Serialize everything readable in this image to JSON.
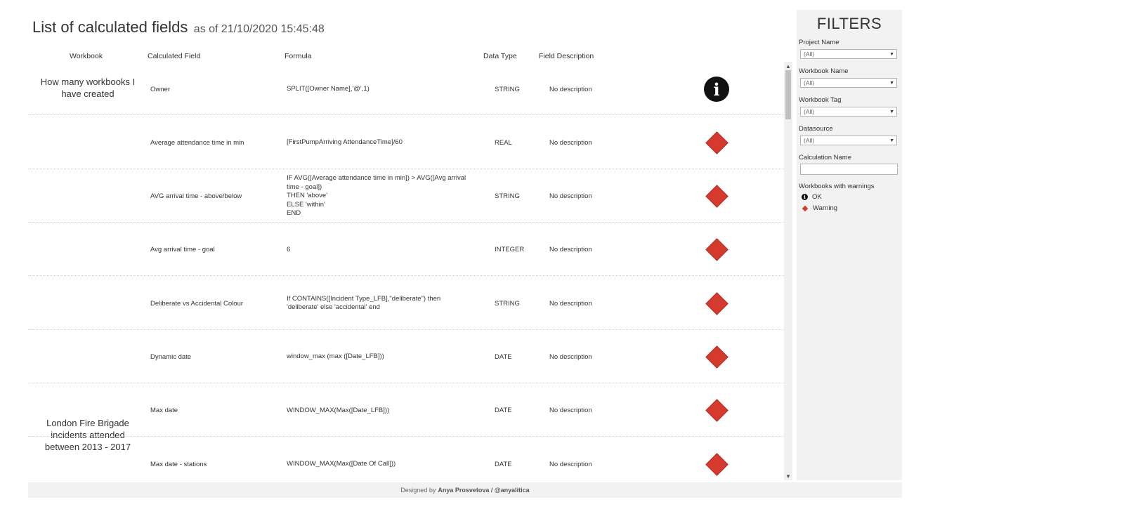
{
  "title": {
    "main": "List of calculated fields",
    "as_of": "as of 21/10/2020 15:45:48"
  },
  "columns": {
    "workbook": "Workbook",
    "field": "Calculated Field",
    "formula": "Formula",
    "type": "Data Type",
    "description": "Field Description"
  },
  "workbooks": [
    {
      "name": "How many workbooks I have created"
    },
    {
      "name": "London Fire Brigade incidents attended between 2013 - 2017"
    }
  ],
  "rows": [
    {
      "field": "Owner",
      "formula": [
        "SPLIT([Owner Name],'@',1)"
      ],
      "type": "STRING",
      "description": "No description",
      "status": "ok",
      "icon": "info-icon"
    },
    {
      "field": "Average attendance time in min",
      "formula": [
        "[FirstPumpArriving AttendanceTime]/60"
      ],
      "type": "REAL",
      "description": "No description",
      "status": "warning",
      "icon": "warning-diamond-icon"
    },
    {
      "field": "AVG arrival time - above/below",
      "formula": [
        "IF AVG([Average attendance time in min]) > AVG([Avg arrival",
        "time - goal])",
        "THEN 'above'",
        "ELSE 'within'",
        "END"
      ],
      "type": "STRING",
      "description": "No description",
      "status": "warning",
      "icon": "warning-diamond-icon"
    },
    {
      "field": "Avg arrival time - goal",
      "formula": [
        "6"
      ],
      "type": "INTEGER",
      "description": "No description",
      "status": "warning",
      "icon": "warning-diamond-icon"
    },
    {
      "field": "Deliberate vs Accidental Colour",
      "formula": [
        "If CONTAINS([Incident Type_LFB],\"deliberate\") then",
        "'deliberate' else 'accidental' end"
      ],
      "type": "STRING",
      "description": "No description",
      "status": "warning",
      "icon": "warning-diamond-icon"
    },
    {
      "field": "Dynamic date",
      "formula": [
        "window_max (max ([Date_LFB]))"
      ],
      "type": "DATE",
      "description": "No description",
      "status": "warning",
      "icon": "warning-diamond-icon"
    },
    {
      "field": "Max date",
      "formula": [
        "WINDOW_MAX(Max([Date_LFB]))"
      ],
      "type": "DATE",
      "description": "No description",
      "status": "warning",
      "icon": "warning-diamond-icon"
    },
    {
      "field": "Max date - stations",
      "formula": [
        "WINDOW_MAX(Max([Date Of Call]))"
      ],
      "type": "DATE",
      "description": "No description",
      "status": "warning",
      "icon": "warning-diamond-icon"
    }
  ],
  "filters": {
    "heading": "FILTERS",
    "project_name": {
      "label": "Project Name",
      "value": "(All)"
    },
    "workbook_name": {
      "label": "Workbook Name",
      "value": "(All)"
    },
    "workbook_tag": {
      "label": "Workbook Tag",
      "value": "(All)"
    },
    "datasource": {
      "label": "Datasource",
      "value": "(All)"
    },
    "calculation_name": {
      "label": "Calculation Name",
      "value": ""
    },
    "warnings_legend": {
      "label": "Workbooks with warnings",
      "ok": "OK",
      "warning": "Warning"
    }
  },
  "icons": {
    "info": "i",
    "scroll_up": "▲",
    "scroll_down": "▼",
    "dropdown": "▼"
  },
  "footer": {
    "prefix": "Designed by",
    "author": "Anya Prosvetova / @anyalitica"
  },
  "colors": {
    "warning": "#d63a2f",
    "ok": "#111111"
  }
}
